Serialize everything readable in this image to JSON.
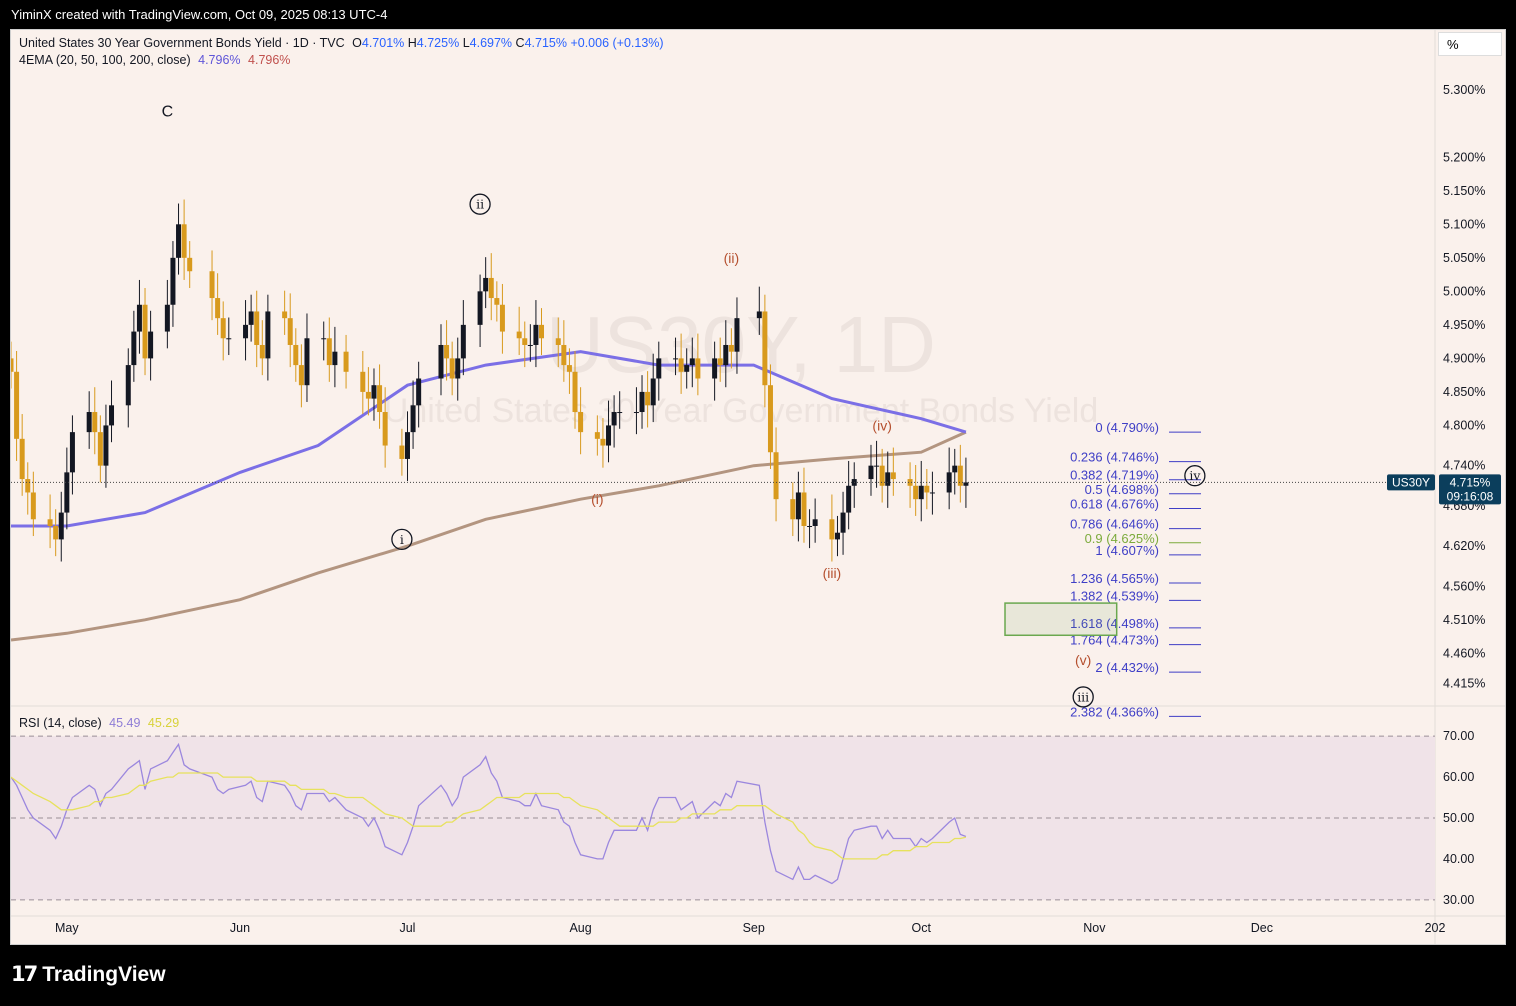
{
  "header": {
    "attribution": "YiminX created with TradingView.com, Oct 09, 2025 08:13 UTC-4"
  },
  "footer": {
    "brand": "TradingView"
  },
  "legend": {
    "symbol_title": "United States 30 Year Government Bonds Yield · 1D · TVC",
    "open_label": "O",
    "open": "4.701%",
    "high_label": "H",
    "high": "4.725%",
    "low_label": "L",
    "low": "4.697%",
    "close_label": "C",
    "close": "4.715%",
    "change": "+0.006 (+0.13%)",
    "ema_label": "4EMA (20, 50, 100, 200, close)",
    "ema_val1": "4.796%",
    "ema_val2": "4.796%",
    "rsi_label": "RSI (14, close)",
    "rsi_val1": "45.49",
    "rsi_val2": "45.29"
  },
  "watermark": {
    "symbol": "US30Y, 1D",
    "name": "United States 30 Year Government Bonds Yield"
  },
  "price_scale": {
    "unit": "%",
    "last_price_symbol": "US30Y",
    "last_price": "4.715%",
    "countdown": "09:16:08"
  },
  "colors": {
    "up": "#131722",
    "down": "#d89a1d",
    "ema_fast": "#7b6fe6",
    "ema_slow": "#b39580",
    "rsi": "#9b87de",
    "rsi_ma": "#e7e25c",
    "fib": "#3e3ec6",
    "fib_green": "#7cab3c",
    "wave_red": "#b5502f",
    "target_box": "#6aa84f"
  },
  "chart_data": {
    "type": "candlestick",
    "title": "United States 30 Year Government Bonds Yield · 1D · TVC",
    "ylabel": "%",
    "ylim": [
      4.38,
      5.36
    ],
    "price_ticks": [
      "5.300%",
      "5.200%",
      "5.150%",
      "5.100%",
      "5.050%",
      "5.000%",
      "4.950%",
      "4.900%",
      "4.850%",
      "4.800%",
      "4.740%",
      "4.680%",
      "4.620%",
      "4.560%",
      "4.510%",
      "4.460%",
      "4.415%"
    ],
    "x_labels": [
      "May",
      "Jun",
      "Jul",
      "Aug",
      "Sep",
      "Oct",
      "Nov",
      "Dec",
      "202"
    ],
    "x_label_dates": [
      "2025-05-01",
      "2025-06-01",
      "2025-07-01",
      "2025-08-01",
      "2025-09-01",
      "2025-10-01",
      "2025-11-01",
      "2025-12-01",
      "2026-01-01"
    ],
    "x_range": [
      "2025-04-21",
      "2026-01-01"
    ],
    "dates": [
      "2025-04-21",
      "2025-04-22",
      "2025-04-23",
      "2025-04-24",
      "2025-04-25",
      "2025-04-28",
      "2025-04-29",
      "2025-04-30",
      "2025-05-01",
      "2025-05-02",
      "2025-05-05",
      "2025-05-06",
      "2025-05-07",
      "2025-05-08",
      "2025-05-09",
      "2025-05-12",
      "2025-05-13",
      "2025-05-14",
      "2025-05-15",
      "2025-05-16",
      "2025-05-19",
      "2025-05-20",
      "2025-05-21",
      "2025-05-22",
      "2025-05-23",
      "2025-05-27",
      "2025-05-28",
      "2025-05-29",
      "2025-05-30",
      "2025-06-02",
      "2025-06-03",
      "2025-06-04",
      "2025-06-05",
      "2025-06-06",
      "2025-06-09",
      "2025-06-10",
      "2025-06-11",
      "2025-06-12",
      "2025-06-13",
      "2025-06-16",
      "2025-06-17",
      "2025-06-18",
      "2025-06-20",
      "2025-06-23",
      "2025-06-24",
      "2025-06-25",
      "2025-06-26",
      "2025-06-27",
      "2025-06-30",
      "2025-07-01",
      "2025-07-02",
      "2025-07-03",
      "2025-07-07",
      "2025-07-08",
      "2025-07-09",
      "2025-07-10",
      "2025-07-11",
      "2025-07-14",
      "2025-07-15",
      "2025-07-16",
      "2025-07-17",
      "2025-07-18",
      "2025-07-21",
      "2025-07-22",
      "2025-07-23",
      "2025-07-24",
      "2025-07-25",
      "2025-07-28",
      "2025-07-29",
      "2025-07-30",
      "2025-07-31",
      "2025-08-01",
      "2025-08-04",
      "2025-08-05",
      "2025-08-06",
      "2025-08-07",
      "2025-08-08",
      "2025-08-11",
      "2025-08-12",
      "2025-08-13",
      "2025-08-14",
      "2025-08-15",
      "2025-08-18",
      "2025-08-19",
      "2025-08-20",
      "2025-08-21",
      "2025-08-22",
      "2025-08-25",
      "2025-08-26",
      "2025-08-27",
      "2025-08-28",
      "2025-08-29",
      "2025-09-02",
      "2025-09-03",
      "2025-09-04",
      "2025-09-05",
      "2025-09-08",
      "2025-09-09",
      "2025-09-10",
      "2025-09-11",
      "2025-09-12",
      "2025-09-15",
      "2025-09-16",
      "2025-09-17",
      "2025-09-18",
      "2025-09-19",
      "2025-09-22",
      "2025-09-23",
      "2025-09-24",
      "2025-09-25",
      "2025-09-26",
      "2025-09-29",
      "2025-09-30",
      "2025-10-01",
      "2025-10-02",
      "2025-10-03",
      "2025-10-06",
      "2025-10-07",
      "2025-10-08",
      "2025-10-09"
    ],
    "closes": [
      4.88,
      4.78,
      4.72,
      4.7,
      4.66,
      4.65,
      4.63,
      4.67,
      4.73,
      4.79,
      4.82,
      4.79,
      4.74,
      4.8,
      4.83,
      4.89,
      4.94,
      4.98,
      4.9,
      4.94,
      4.98,
      5.05,
      5.1,
      5.05,
      5.03,
      4.99,
      4.96,
      4.93,
      4.93,
      4.95,
      4.97,
      4.92,
      4.9,
      4.97,
      4.96,
      4.92,
      4.89,
      4.86,
      4.93,
      4.93,
      4.89,
      4.91,
      4.88,
      4.85,
      4.84,
      4.86,
      4.82,
      4.77,
      4.75,
      4.79,
      4.83,
      4.87,
      4.92,
      4.9,
      4.87,
      4.9,
      4.95,
      5.0,
      5.02,
      4.99,
      4.98,
      4.94,
      4.93,
      4.92,
      4.92,
      4.95,
      4.93,
      4.92,
      4.89,
      4.88,
      4.82,
      4.79,
      4.78,
      4.77,
      4.8,
      4.82,
      4.82,
      4.82,
      4.85,
      4.83,
      4.87,
      4.9,
      4.9,
      4.88,
      4.89,
      4.9,
      4.87,
      4.9,
      4.89,
      4.92,
      4.91,
      4.96,
      4.97,
      4.86,
      4.76,
      4.69,
      4.66,
      4.7,
      4.65,
      4.65,
      4.66,
      4.63,
      4.64,
      4.67,
      4.71,
      4.72,
      4.74,
      4.74,
      4.71,
      4.73,
      4.72,
      4.71,
      4.69,
      4.71,
      4.7,
      4.7,
      4.73,
      4.74,
      4.71,
      4.715
    ],
    "ema_fast": {
      "name": "EMA (fast)",
      "dates": [
        "2025-04-21",
        "2025-05-01",
        "2025-05-15",
        "2025-06-01",
        "2025-06-15",
        "2025-07-01",
        "2025-07-15",
        "2025-08-01",
        "2025-08-15",
        "2025-09-01",
        "2025-09-15",
        "2025-10-01",
        "2025-10-09"
      ],
      "values": [
        4.65,
        4.65,
        4.67,
        4.73,
        4.77,
        4.86,
        4.89,
        4.91,
        4.89,
        4.89,
        4.84,
        4.81,
        4.79
      ]
    },
    "ema_slow": {
      "name": "EMA (slow)",
      "dates": [
        "2025-04-21",
        "2025-05-01",
        "2025-05-15",
        "2025-06-01",
        "2025-06-15",
        "2025-07-01",
        "2025-07-15",
        "2025-08-01",
        "2025-08-15",
        "2025-09-01",
        "2025-09-15",
        "2025-10-01",
        "2025-10-09"
      ],
      "values": [
        4.48,
        4.49,
        4.51,
        4.54,
        4.58,
        4.62,
        4.66,
        4.69,
        4.71,
        4.74,
        4.75,
        4.76,
        4.79
      ]
    },
    "fib_levels": [
      {
        "ratio": "0",
        "price": "4.790%",
        "label": "0 (4.790%)",
        "p": 4.79
      },
      {
        "ratio": "0.236",
        "price": "4.746%",
        "label": "0.236 (4.746%)",
        "p": 4.746
      },
      {
        "ratio": "0.382",
        "price": "4.719%",
        "label": "0.382 (4.719%)",
        "p": 4.719
      },
      {
        "ratio": "0.5",
        "price": "4.698%",
        "label": "0.5 (4.698%)",
        "p": 4.698
      },
      {
        "ratio": "0.618",
        "price": "4.676%",
        "label": "0.618 (4.676%)",
        "p": 4.676
      },
      {
        "ratio": "0.786",
        "price": "4.646%",
        "label": "0.786 (4.646%)",
        "p": 4.646
      },
      {
        "ratio": "0.9",
        "price": "4.625%",
        "label": "0.9 (4.625%)",
        "p": 4.625,
        "green": true
      },
      {
        "ratio": "1",
        "price": "4.607%",
        "label": "1 (4.607%)",
        "p": 4.607
      },
      {
        "ratio": "1.236",
        "price": "4.565%",
        "label": "1.236 (4.565%)",
        "p": 4.565
      },
      {
        "ratio": "1.382",
        "price": "4.539%",
        "label": "1.382 (4.539%)",
        "p": 4.539
      },
      {
        "ratio": "1.618",
        "price": "4.498%",
        "label": "1.618 (4.498%)",
        "p": 4.498
      },
      {
        "ratio": "1.764",
        "price": "4.473%",
        "label": "1.764 (4.473%)",
        "p": 4.473
      },
      {
        "ratio": "2",
        "price": "4.432%",
        "label": "2 (4.432%)",
        "p": 4.432
      },
      {
        "ratio": "2.382",
        "price": "4.366%",
        "label": "2.382 (4.366%)",
        "p": 4.366
      }
    ],
    "wave_labels": [
      {
        "text": "C",
        "date": "2025-05-19",
        "price": 5.27,
        "style": "plain"
      },
      {
        "text": "ii",
        "date": "2025-07-14",
        "price": 5.13,
        "style": "circle"
      },
      {
        "text": "i",
        "date": "2025-06-30",
        "price": 4.63,
        "style": "circle"
      },
      {
        "text": "(ii)",
        "date": "2025-08-28",
        "price": 5.05,
        "style": "red"
      },
      {
        "text": "(i)",
        "date": "2025-08-04",
        "price": 4.69,
        "style": "red"
      },
      {
        "text": "(iv)",
        "date": "2025-09-24",
        "price": 4.8,
        "style": "red"
      },
      {
        "text": "(iii)",
        "date": "2025-09-15",
        "price": 4.58,
        "style": "red"
      },
      {
        "text": "iv",
        "date": "2025-11-19",
        "price": 4.725,
        "style": "circle"
      },
      {
        "text": "(v)",
        "date": "2025-10-30",
        "price": 4.45,
        "style": "red"
      },
      {
        "text": "iii",
        "date": "2025-10-30",
        "price": 4.395,
        "style": "circle"
      }
    ],
    "target_zone": {
      "date_from": "2025-10-16",
      "date_to": "2025-11-05",
      "high": 4.535,
      "low": 4.487
    },
    "rsi": {
      "ylim": [
        28,
        72
      ],
      "ticks": [
        "70.00",
        "60.00",
        "50.00",
        "40.00",
        "30.00"
      ],
      "overbought": 70,
      "mid": 50,
      "oversold": 30,
      "values": [
        60,
        58,
        55,
        52,
        50,
        47,
        45,
        48,
        52,
        55,
        58,
        57,
        53,
        56,
        57,
        62,
        63,
        64,
        57,
        62,
        64,
        66,
        68,
        63,
        62,
        60,
        57,
        56,
        57,
        58,
        59,
        55,
        54,
        59,
        58,
        56,
        53,
        52,
        56,
        56,
        54,
        55,
        52,
        50,
        48,
        50,
        47,
        43,
        41,
        44,
        48,
        53,
        58,
        56,
        53,
        55,
        60,
        63,
        65,
        61,
        59,
        55,
        54,
        53,
        53,
        56,
        53,
        52,
        49,
        48,
        44,
        41,
        40,
        40,
        44,
        47,
        47,
        47,
        50,
        47,
        52,
        55,
        55,
        52,
        53,
        54,
        50,
        54,
        53,
        56,
        55,
        59,
        58,
        49,
        42,
        37,
        35,
        38,
        35,
        35,
        36,
        34,
        35,
        40,
        45,
        47,
        48,
        48,
        45,
        47,
        45,
        45,
        43,
        45,
        44,
        45,
        49,
        50,
        46,
        45.49
      ],
      "ma_values": [
        60,
        59,
        58,
        57,
        56,
        54,
        53,
        52,
        52,
        52,
        53,
        54,
        54,
        55,
        55,
        56,
        57,
        58,
        58,
        59,
        60,
        60,
        61,
        61,
        61,
        61,
        61,
        60,
        60,
        60,
        60,
        59,
        59,
        59,
        59,
        58,
        58,
        57,
        57,
        57,
        56,
        56,
        55,
        55,
        54,
        53,
        52,
        51,
        50,
        49,
        48,
        48,
        48,
        49,
        49,
        50,
        51,
        52,
        53,
        54,
        55,
        55,
        55,
        56,
        56,
        56,
        56,
        56,
        55,
        55,
        54,
        53,
        52,
        51,
        50,
        49,
        48,
        48,
        48,
        48,
        48,
        49,
        49,
        50,
        50,
        51,
        51,
        51,
        52,
        52,
        52,
        53,
        53,
        53,
        52,
        51,
        49,
        47,
        46,
        44,
        43,
        42,
        41,
        40,
        40,
        40,
        40,
        40,
        41,
        41,
        42,
        42,
        43,
        43,
        43,
        44,
        44,
        45,
        45,
        45.29
      ]
    }
  }
}
